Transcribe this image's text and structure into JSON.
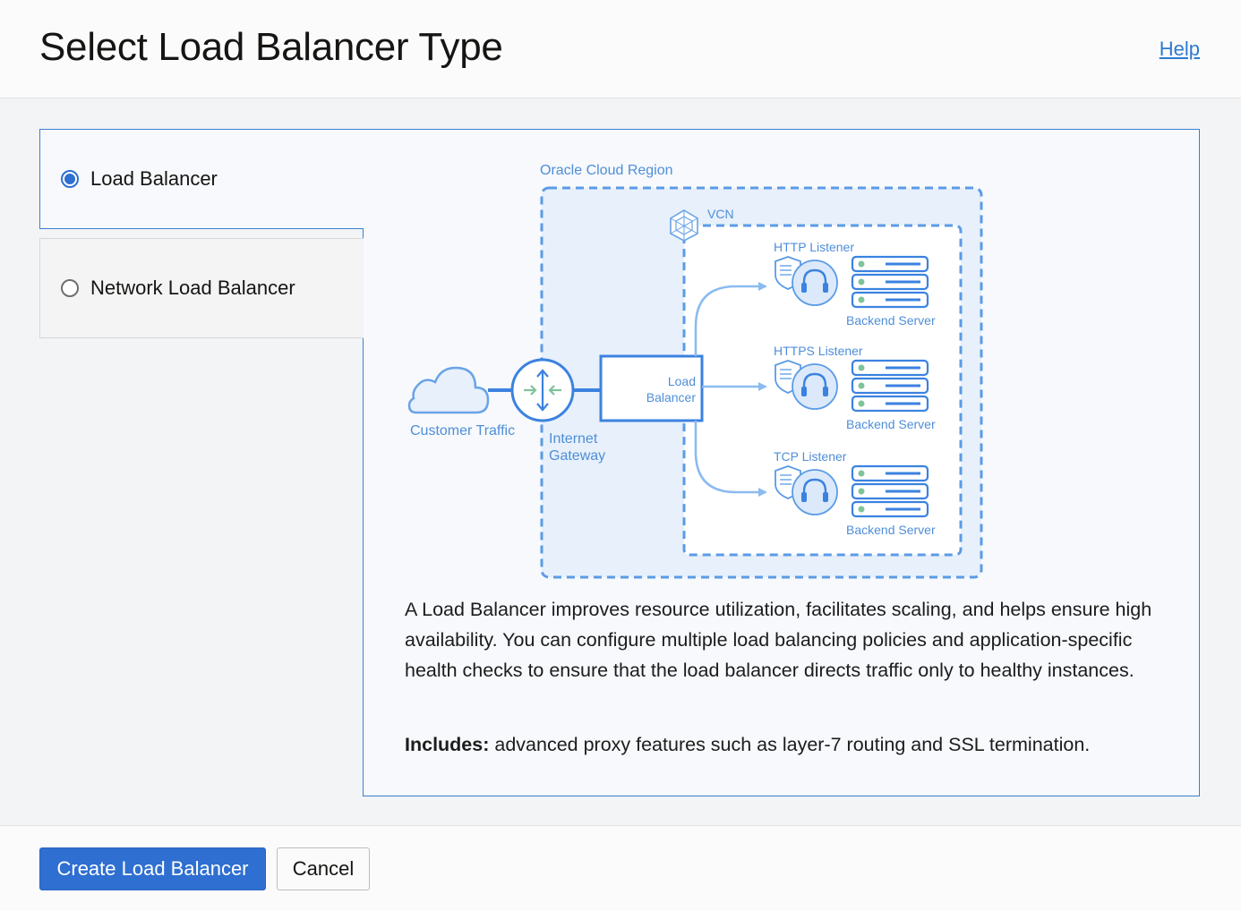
{
  "header": {
    "title": "Select Load Balancer Type",
    "help_label": "Help"
  },
  "options": [
    {
      "label": "Load Balancer",
      "selected": true
    },
    {
      "label": "Network Load Balancer",
      "selected": false
    }
  ],
  "diagram": {
    "region_label": "Oracle Cloud Region",
    "vcn_label": "VCN",
    "customer_traffic_label": "Customer Traffic",
    "gateway_label_line1": "Internet",
    "gateway_label_line2": "Gateway",
    "lb_label_line1": "Load",
    "lb_label_line2": "Balancer",
    "listeners": [
      {
        "label": "HTTP Listener",
        "server_label": "Backend Server"
      },
      {
        "label": "HTTPS Listener",
        "server_label": "Backend Server"
      },
      {
        "label": "TCP Listener",
        "server_label": "Backend Server"
      }
    ]
  },
  "description": "A Load Balancer improves resource utilization, facilitates scaling, and helps ensure high availability. You can configure multiple load balancing policies and application-specific health checks to ensure that the load balancer directs traffic only to healthy instances.",
  "includes": {
    "label": "Includes:",
    "text": " advanced proxy features such as layer-7 routing and SSL termination."
  },
  "footer": {
    "primary_label": "Create Load Balancer",
    "secondary_label": "Cancel"
  },
  "colors": {
    "accent": "#2e6fd1",
    "diagram_blue": "#5b9be6"
  }
}
